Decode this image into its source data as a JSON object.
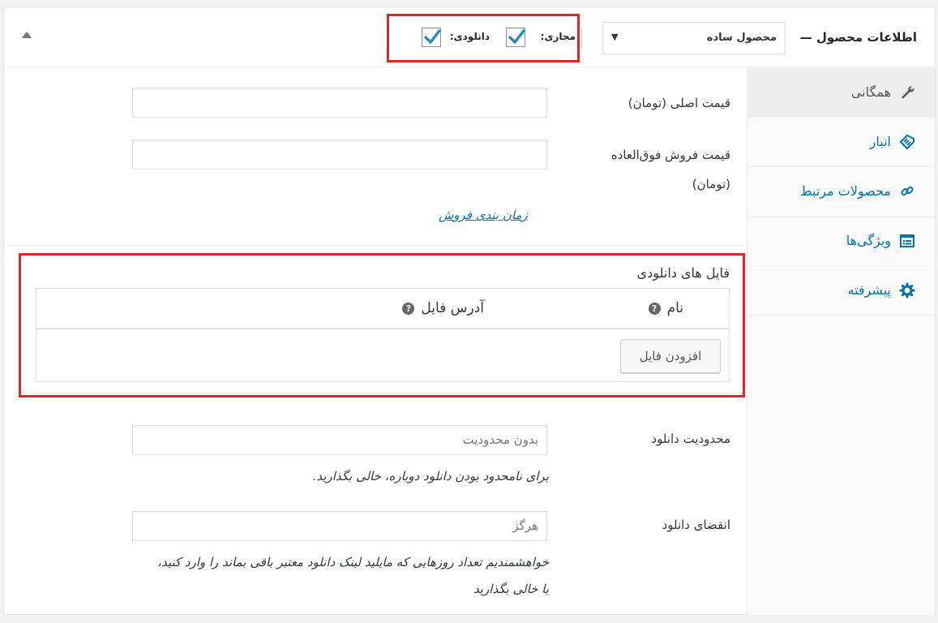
{
  "header": {
    "title": "اطلاعات محصول —",
    "product_type": "محصول ساده",
    "virtual_label": "مجازی:",
    "downloadable_label": "دانلودی:",
    "virtual_checked": true,
    "downloadable_checked": true
  },
  "tabs": [
    {
      "label": "همگانی",
      "icon": "wrench-icon",
      "active": true
    },
    {
      "label": "انبار",
      "icon": "tag-icon",
      "active": false
    },
    {
      "label": "محصولات مرتبط",
      "icon": "link-icon",
      "active": false
    },
    {
      "label": "ویژگی‌ها",
      "icon": "list-icon",
      "active": false
    },
    {
      "label": "پیشرفته",
      "icon": "gear-icon",
      "active": false
    }
  ],
  "general": {
    "regular_price_label": "قیمت اصلی (تومان)",
    "sale_price_label_line1": "قیمت فروش فوق‌العاده",
    "sale_price_label_line2": "(تومان)",
    "schedule_link": "زمان بندی فروش"
  },
  "downloads": {
    "title": "فایل های دانلودی",
    "col_name": "نام",
    "col_url": "آدرس فایل",
    "add_button": "افزودن فایل"
  },
  "download_limit": {
    "label": "محدودیت دانلود",
    "placeholder": "بدون محدودیت",
    "description": "برای نامحدود بودن دانلود دوباره، خالی بگذارید."
  },
  "download_expiry": {
    "label": "انقضای دانلود",
    "placeholder": "هرگز",
    "description_line1": "خواهشمندیم تعداد روزهایی که مایلید لینک دانلود معتبر باقی بماند را وارد کنید،",
    "description_line2": "یا خالی بگذارید"
  },
  "colors": {
    "accent": "#0073aa",
    "highlight": "#dd2629",
    "check": "#1e8cbe"
  }
}
